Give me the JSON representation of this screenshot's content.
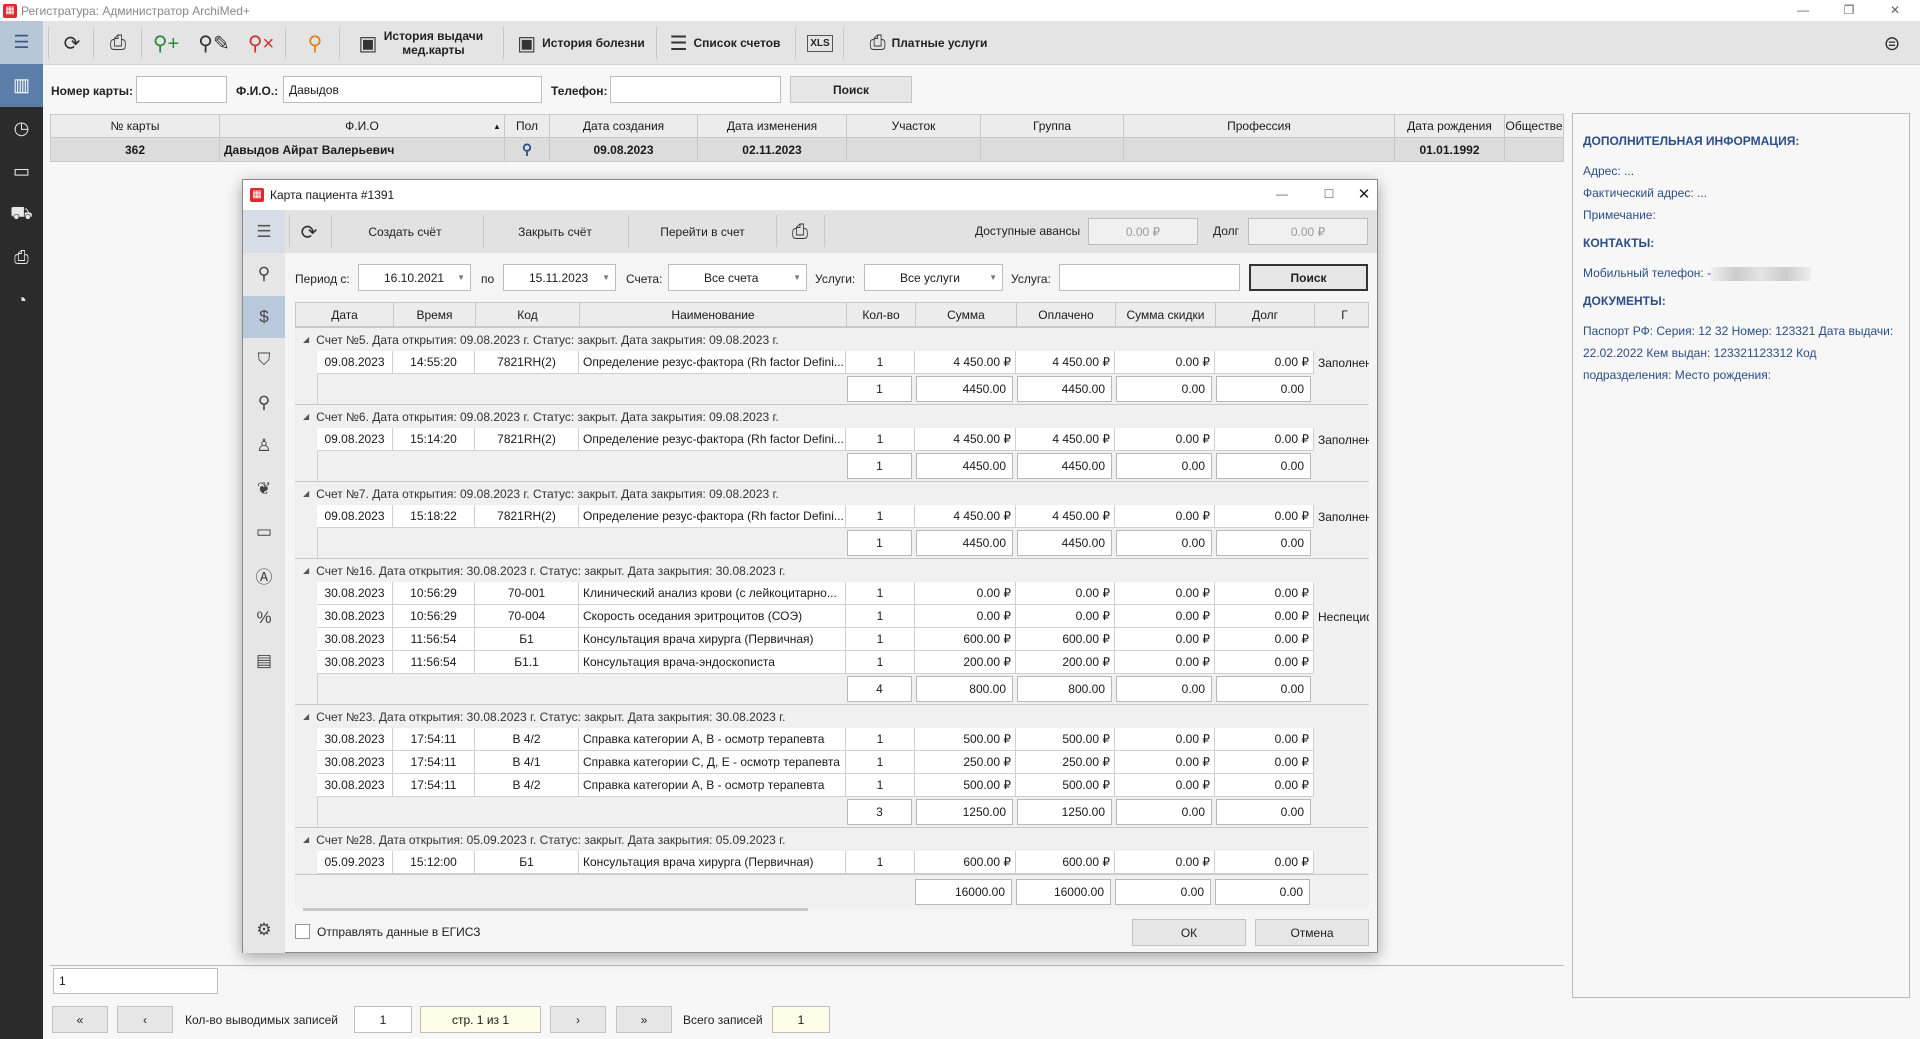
{
  "app": {
    "title": "Регистратура: Администратор ArchiMed+"
  },
  "sidebar": {
    "items": [
      "menu-icon",
      "cards-icon",
      "schedule-icon",
      "ticket-icon",
      "ambulance-icon",
      "paid-services-icon",
      "check-clock-icon"
    ]
  },
  "toolbar": {
    "history_card": "История выдачи мед.карты",
    "history_disease": "История болезни",
    "bills_list": "Список счетов",
    "xls": "XLS",
    "paid_services": "Платные услуги"
  },
  "search": {
    "card_label": "Номер карты:",
    "card_value": "",
    "fio_label": "Ф.И.О.:",
    "fio_value": "Давыдов",
    "phone_label": "Телефон:",
    "phone_value": "",
    "button": "Поиск"
  },
  "patients": {
    "columns": [
      "№ карты",
      "Ф.И.О",
      "Пол",
      "Дата создания",
      "Дата изменения",
      "Участок",
      "Группа",
      "Профессия",
      "Дата рождения",
      "Обществе"
    ],
    "rows": [
      [
        "362",
        "Давыдов Айрат Валерьевич",
        "",
        "09.08.2023",
        "02.11.2023",
        "",
        "",
        "",
        "01.01.1992",
        ""
      ]
    ]
  },
  "info": {
    "h1": "ДОПОЛНИТЕЛЬНАЯ ИНФОРМАЦИЯ:",
    "address": "Адрес: ...",
    "fact_address": "Фактический адрес: ...",
    "note": "Примечание:",
    "h2": "КОНТАКТЫ:",
    "mobile": "Мобильный телефон: -",
    "h3": "ДОКУМЕНТЫ:",
    "passport": "Паспорт РФ: Серия: 12 32 Номер: 123321 Дата выдачи: 22.02.2022 Кем выдан: 123321123312 Код подразделения:  Место рождения:"
  },
  "bottom": {
    "filter_value": "1",
    "records_label": "Кол-во выводимых записей",
    "records_value": "1",
    "page": "стр. 1 из 1",
    "total_label": "Всего записей",
    "total_value": "1"
  },
  "modal": {
    "title": "Карта пациента #1391",
    "toolbar": {
      "create": "Создать счёт",
      "close": "Закрыть счёт",
      "goto": "Перейти в счет",
      "advances_label": "Доступные авансы",
      "advances_value": "0.00 ₽",
      "debt_label": "Долг",
      "debt_value": "0.00 ₽"
    },
    "filter": {
      "period_label": "Период с:",
      "date_from": "16.10.2021",
      "to_label": "по",
      "date_to": "15.11.2023",
      "bills_label": "Счета:",
      "bills_value": "Все счета",
      "services_label": "Услуги:",
      "services_value": "Все услуги",
      "service_label": "Услуга:",
      "service_value": "",
      "search": "Поиск"
    },
    "grid": {
      "columns": [
        "Дата",
        "Время",
        "Код",
        "Наименование",
        "Кол-во",
        "Сумма",
        "Оплачено",
        "Сумма скидки",
        "Долг",
        "Г"
      ],
      "groups": [
        {
          "header": "Счет №5. Дата открытия: 09.08.2023 г. Статус: закрыт. Дата закрытия: 09.08.2023 г.",
          "rows": [
            [
              "09.08.2023",
              "14:55:20",
              "7821RH(2)",
              "Определение резус-фактора (Rh factor Defini...",
              "1",
              "4 450.00 ₽",
              "4 450.00 ₽",
              "0.00 ₽",
              "0.00 ₽",
              "Заполнен"
            ]
          ],
          "total": [
            "1",
            "4450.00",
            "4450.00",
            "0.00",
            "0.00"
          ]
        },
        {
          "header": "Счет №6. Дата открытия: 09.08.2023 г. Статус: закрыт. Дата закрытия: 09.08.2023 г.",
          "rows": [
            [
              "09.08.2023",
              "15:14:20",
              "7821RH(2)",
              "Определение резус-фактора (Rh factor Defini...",
              "1",
              "4 450.00 ₽",
              "4 450.00 ₽",
              "0.00 ₽",
              "0.00 ₽",
              "Заполнен"
            ]
          ],
          "total": [
            "1",
            "4450.00",
            "4450.00",
            "0.00",
            "0.00"
          ]
        },
        {
          "header": "Счет №7. Дата открытия: 09.08.2023 г. Статус: закрыт. Дата закрытия: 09.08.2023 г.",
          "rows": [
            [
              "09.08.2023",
              "15:18:22",
              "7821RH(2)",
              "Определение резус-фактора (Rh factor Defini...",
              "1",
              "4 450.00 ₽",
              "4 450.00 ₽",
              "0.00 ₽",
              "0.00 ₽",
              "Заполнен"
            ]
          ],
          "total": [
            "1",
            "4450.00",
            "4450.00",
            "0.00",
            "0.00"
          ]
        },
        {
          "header": "Счет №16. Дата открытия: 30.08.2023 г. Статус: закрыт. Дата закрытия: 30.08.2023 г.",
          "rows": [
            [
              "30.08.2023",
              "10:56:29",
              "70-001",
              "Клинический анализ крови (с лейкоцитарно...",
              "1",
              "0.00 ₽",
              "0.00 ₽",
              "0.00 ₽",
              "0.00 ₽",
              ""
            ],
            [
              "30.08.2023",
              "10:56:29",
              "70-004",
              "Скорость оседания эритроцитов (СОЭ)",
              "1",
              "0.00 ₽",
              "0.00 ₽",
              "0.00 ₽",
              "0.00 ₽",
              "Неспециф"
            ],
            [
              "30.08.2023",
              "11:56:54",
              "Б1",
              "Консультация врача хирурга (Первичная)",
              "1",
              "600.00 ₽",
              "600.00 ₽",
              "0.00 ₽",
              "0.00 ₽",
              ""
            ],
            [
              "30.08.2023",
              "11:56:54",
              "Б1.1",
              "Консультация врача-эндоскописта",
              "1",
              "200.00 ₽",
              "200.00 ₽",
              "0.00 ₽",
              "0.00 ₽",
              ""
            ]
          ],
          "total": [
            "4",
            "800.00",
            "800.00",
            "0.00",
            "0.00"
          ]
        },
        {
          "header": "Счет №23. Дата открытия: 30.08.2023 г. Статус: закрыт. Дата закрытия: 30.08.2023 г.",
          "rows": [
            [
              "30.08.2023",
              "17:54:11",
              "В 4/2",
              "Справка категории А, В - осмотр терапевта",
              "1",
              "500.00 ₽",
              "500.00 ₽",
              "0.00 ₽",
              "0.00 ₽",
              ""
            ],
            [
              "30.08.2023",
              "17:54:11",
              "В 4/1",
              "Справка категории С, Д, Е - осмотр терапевта",
              "1",
              "250.00 ₽",
              "250.00 ₽",
              "0.00 ₽",
              "0.00 ₽",
              ""
            ],
            [
              "30.08.2023",
              "17:54:11",
              "В 4/2",
              "Справка категории А, В - осмотр терапевта",
              "1",
              "500.00 ₽",
              "500.00 ₽",
              "0.00 ₽",
              "0.00 ₽",
              ""
            ]
          ],
          "total": [
            "3",
            "1250.00",
            "1250.00",
            "0.00",
            "0.00"
          ]
        },
        {
          "header": "Счет №28. Дата открытия: 05.09.2023 г. Статус: закрыт. Дата закрытия: 05.09.2023 г.",
          "rows": [
            [
              "05.09.2023",
              "15:12:00",
              "Б1",
              "Консультация врача хирурга (Первичная)",
              "1",
              "600.00 ₽",
              "600.00 ₽",
              "0.00 ₽",
              "0.00 ₽",
              ""
            ]
          ],
          "total": null
        }
      ],
      "grand_total": [
        "16000.00",
        "16000.00",
        "0.00",
        "0.00"
      ]
    },
    "egisz_label": "Отправлять данные в ЕГИСЗ",
    "egisz_checked": false,
    "ok": "ОК",
    "cancel": "Отмена"
  }
}
